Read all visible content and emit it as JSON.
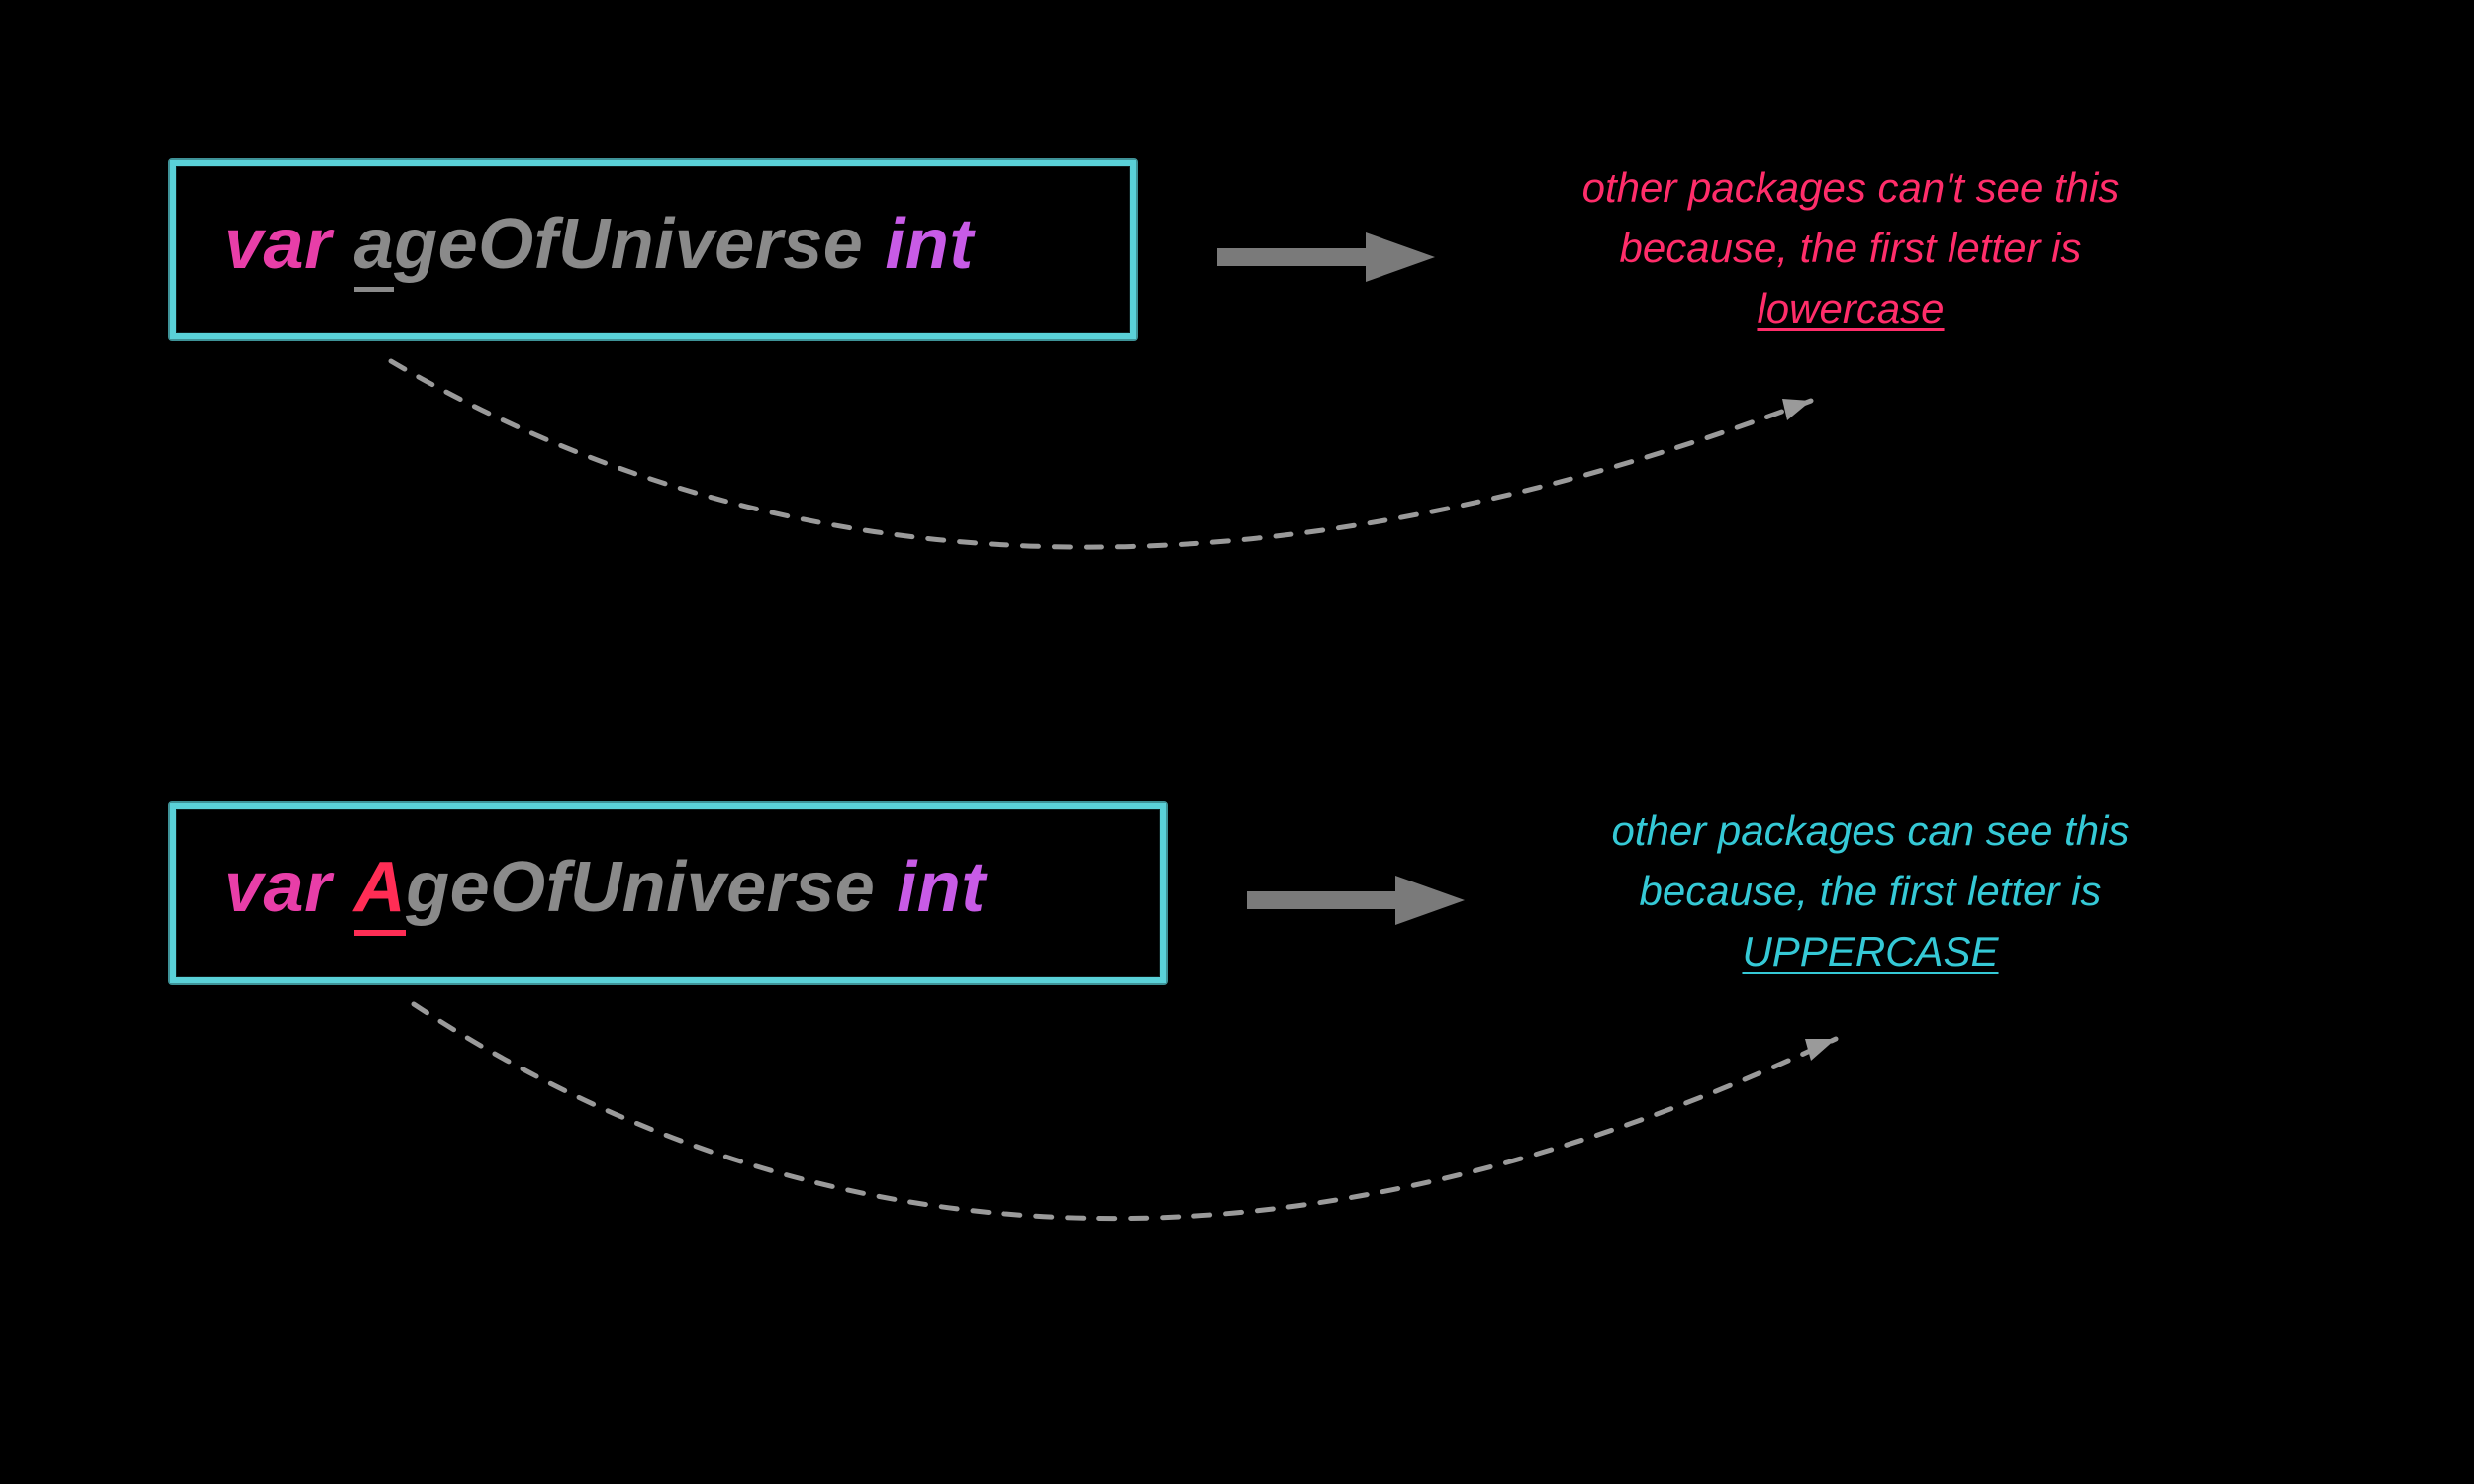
{
  "colors": {
    "background": "#000000",
    "border": "#5ad1d8",
    "keyword": "#e83ea8",
    "identifier": "#8a8a8a",
    "firstLetterUpper": "#ff2d55",
    "type": "#c85be6",
    "noteRed": "#ff2d6a",
    "noteCyan": "#35c9d6",
    "arrow": "#7a7a7a",
    "dash": "#9a9a9a"
  },
  "top": {
    "keyword": "var",
    "firstLetter": "a",
    "rest": "geOfUniverse",
    "type": "int",
    "note_l1": "other packages can't see this",
    "note_l2": "because, the first letter is",
    "note_key": "lowercase"
  },
  "bottom": {
    "keyword": "var",
    "firstLetter": "A",
    "rest": "geOfUniverse",
    "type": "int",
    "note_l1": "other packages can see this",
    "note_l2": "because, the first letter is",
    "note_key": "UPPERCASE"
  }
}
